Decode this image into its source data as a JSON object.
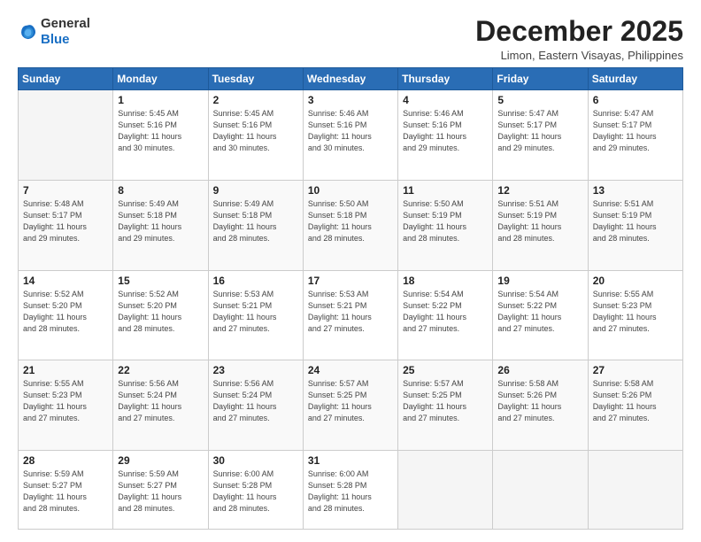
{
  "logo": {
    "general": "General",
    "blue": "Blue"
  },
  "title": "December 2025",
  "location": "Limon, Eastern Visayas, Philippines",
  "days_header": [
    "Sunday",
    "Monday",
    "Tuesday",
    "Wednesday",
    "Thursday",
    "Friday",
    "Saturday"
  ],
  "weeks": [
    [
      {
        "day": "",
        "detail": ""
      },
      {
        "day": "1",
        "detail": "Sunrise: 5:45 AM\nSunset: 5:16 PM\nDaylight: 11 hours\nand 30 minutes."
      },
      {
        "day": "2",
        "detail": "Sunrise: 5:45 AM\nSunset: 5:16 PM\nDaylight: 11 hours\nand 30 minutes."
      },
      {
        "day": "3",
        "detail": "Sunrise: 5:46 AM\nSunset: 5:16 PM\nDaylight: 11 hours\nand 30 minutes."
      },
      {
        "day": "4",
        "detail": "Sunrise: 5:46 AM\nSunset: 5:16 PM\nDaylight: 11 hours\nand 29 minutes."
      },
      {
        "day": "5",
        "detail": "Sunrise: 5:47 AM\nSunset: 5:17 PM\nDaylight: 11 hours\nand 29 minutes."
      },
      {
        "day": "6",
        "detail": "Sunrise: 5:47 AM\nSunset: 5:17 PM\nDaylight: 11 hours\nand 29 minutes."
      }
    ],
    [
      {
        "day": "7",
        "detail": "Sunrise: 5:48 AM\nSunset: 5:17 PM\nDaylight: 11 hours\nand 29 minutes."
      },
      {
        "day": "8",
        "detail": "Sunrise: 5:49 AM\nSunset: 5:18 PM\nDaylight: 11 hours\nand 29 minutes."
      },
      {
        "day": "9",
        "detail": "Sunrise: 5:49 AM\nSunset: 5:18 PM\nDaylight: 11 hours\nand 28 minutes."
      },
      {
        "day": "10",
        "detail": "Sunrise: 5:50 AM\nSunset: 5:18 PM\nDaylight: 11 hours\nand 28 minutes."
      },
      {
        "day": "11",
        "detail": "Sunrise: 5:50 AM\nSunset: 5:19 PM\nDaylight: 11 hours\nand 28 minutes."
      },
      {
        "day": "12",
        "detail": "Sunrise: 5:51 AM\nSunset: 5:19 PM\nDaylight: 11 hours\nand 28 minutes."
      },
      {
        "day": "13",
        "detail": "Sunrise: 5:51 AM\nSunset: 5:19 PM\nDaylight: 11 hours\nand 28 minutes."
      }
    ],
    [
      {
        "day": "14",
        "detail": "Sunrise: 5:52 AM\nSunset: 5:20 PM\nDaylight: 11 hours\nand 28 minutes."
      },
      {
        "day": "15",
        "detail": "Sunrise: 5:52 AM\nSunset: 5:20 PM\nDaylight: 11 hours\nand 28 minutes."
      },
      {
        "day": "16",
        "detail": "Sunrise: 5:53 AM\nSunset: 5:21 PM\nDaylight: 11 hours\nand 27 minutes."
      },
      {
        "day": "17",
        "detail": "Sunrise: 5:53 AM\nSunset: 5:21 PM\nDaylight: 11 hours\nand 27 minutes."
      },
      {
        "day": "18",
        "detail": "Sunrise: 5:54 AM\nSunset: 5:22 PM\nDaylight: 11 hours\nand 27 minutes."
      },
      {
        "day": "19",
        "detail": "Sunrise: 5:54 AM\nSunset: 5:22 PM\nDaylight: 11 hours\nand 27 minutes."
      },
      {
        "day": "20",
        "detail": "Sunrise: 5:55 AM\nSunset: 5:23 PM\nDaylight: 11 hours\nand 27 minutes."
      }
    ],
    [
      {
        "day": "21",
        "detail": "Sunrise: 5:55 AM\nSunset: 5:23 PM\nDaylight: 11 hours\nand 27 minutes."
      },
      {
        "day": "22",
        "detail": "Sunrise: 5:56 AM\nSunset: 5:24 PM\nDaylight: 11 hours\nand 27 minutes."
      },
      {
        "day": "23",
        "detail": "Sunrise: 5:56 AM\nSunset: 5:24 PM\nDaylight: 11 hours\nand 27 minutes."
      },
      {
        "day": "24",
        "detail": "Sunrise: 5:57 AM\nSunset: 5:25 PM\nDaylight: 11 hours\nand 27 minutes."
      },
      {
        "day": "25",
        "detail": "Sunrise: 5:57 AM\nSunset: 5:25 PM\nDaylight: 11 hours\nand 27 minutes."
      },
      {
        "day": "26",
        "detail": "Sunrise: 5:58 AM\nSunset: 5:26 PM\nDaylight: 11 hours\nand 27 minutes."
      },
      {
        "day": "27",
        "detail": "Sunrise: 5:58 AM\nSunset: 5:26 PM\nDaylight: 11 hours\nand 27 minutes."
      }
    ],
    [
      {
        "day": "28",
        "detail": "Sunrise: 5:59 AM\nSunset: 5:27 PM\nDaylight: 11 hours\nand 28 minutes."
      },
      {
        "day": "29",
        "detail": "Sunrise: 5:59 AM\nSunset: 5:27 PM\nDaylight: 11 hours\nand 28 minutes."
      },
      {
        "day": "30",
        "detail": "Sunrise: 6:00 AM\nSunset: 5:28 PM\nDaylight: 11 hours\nand 28 minutes."
      },
      {
        "day": "31",
        "detail": "Sunrise: 6:00 AM\nSunset: 5:28 PM\nDaylight: 11 hours\nand 28 minutes."
      },
      {
        "day": "",
        "detail": ""
      },
      {
        "day": "",
        "detail": ""
      },
      {
        "day": "",
        "detail": ""
      }
    ]
  ]
}
